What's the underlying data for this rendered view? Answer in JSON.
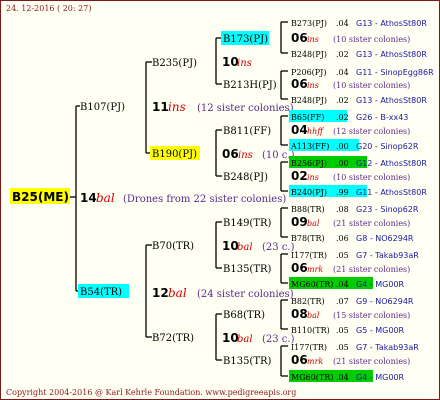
{
  "date": "24. 12-2016 ( 20: 27)",
  "footer": "Copyright 2004-2016 @ Karl Kehrle Foundation.   www.pedigreeapis.org",
  "colors": {
    "yellow": "#ffff00",
    "cyan": "#00ffff",
    "green": "#00cc00",
    "brown": "#8a1a1a",
    "purple": "#5a2a8a",
    "red": "#d00000",
    "blue": "#1a1aa0"
  },
  "root": {
    "id": "B25(ME)",
    "num": "14",
    "ins": "bal",
    "note": "(Drones from 22 sister colonies)"
  },
  "g1": [
    {
      "id": "B107(PJ)",
      "num": "11",
      "ins": "ins",
      "note": "(12 sister colonies)"
    },
    {
      "id": "B54(TR)",
      "num": "12",
      "ins": "bal",
      "note": "(24 sister colonies)"
    }
  ],
  "g2": [
    {
      "id": "B235(PJ)",
      "num": "10",
      "ins": "ins",
      "note": ""
    },
    {
      "id": "B190(PJ)",
      "num": "06",
      "ins": "ins",
      "note": "(10 c.)"
    },
    {
      "id": "B70(TR)",
      "num": "10",
      "ins": "bal",
      "note": "(23 c.)"
    },
    {
      "id": "B72(TR)",
      "num": "10",
      "ins": "bal",
      "note": "(23 c.)"
    }
  ],
  "g3": [
    "B173(PJ)",
    "B213H(PJ)",
    "B811(FF)",
    "B248(PJ)",
    "B149(TR)",
    "B135(TR)",
    "B68(TR)",
    "B135(TR)"
  ],
  "g4": [
    {
      "id": "B273(PJ)",
      "yr": ".04",
      "ref": "G13 - AthosSt80R"
    },
    {
      "num": "06",
      "ins": "ins",
      "note": "(10 sister colonies)"
    },
    {
      "id": "B248(PJ)",
      "yr": ".02",
      "ref": "G13 - AthosSt80R"
    },
    {
      "id": "P206(PJ)",
      "yr": ".04",
      "ref": "G11 - SinopEgg86R"
    },
    {
      "num": "06",
      "ins": "ins",
      "note": "(10 sister colonies)"
    },
    {
      "id": "B248(PJ)",
      "yr": ".02",
      "ref": "G13 - AthosSt80R"
    },
    {
      "id": "B65(FF)",
      "yr": ".02",
      "ref": "G26 - B-xx43"
    },
    {
      "num": "04",
      "ins": "hhff",
      "note": "(12 sister colonies)"
    },
    {
      "id": "A113(FF)",
      "yr": ".00",
      "ref": "G20 - Sinop62R"
    },
    {
      "id": "B256(PJ)",
      "yr": ".00",
      "ref": "G12 - AthosSt80R"
    },
    {
      "num": "02",
      "ins": "ins",
      "note": "(10 sister colonies)"
    },
    {
      "id": "B240(PJ)",
      "yr": ".99",
      "ref": "G11 - AthosSt80R"
    },
    {
      "id": "B88(TR)",
      "yr": ".08",
      "ref": "G23 - Sinop62R"
    },
    {
      "num": "09",
      "ins": "bal",
      "note": "(21 sister colonies)"
    },
    {
      "id": "B78(TR)",
      "yr": ".06",
      "ref": "G8 - NO6294R"
    },
    {
      "id": "I177(TR)",
      "yr": ".05",
      "ref": "G7 - Takab93aR"
    },
    {
      "num": "06",
      "ins": "mrk",
      "note": "(21 sister colonies)"
    },
    {
      "id": "MG60(TR)",
      "yr": ".04",
      "ref": "G4 - MG00R"
    },
    {
      "id": "B82(TR)",
      "yr": ".07",
      "ref": "G9 - NO6294R"
    },
    {
      "num": "08",
      "ins": "bal",
      "note": "(15 sister colonies)"
    },
    {
      "id": "B110(TR)",
      "yr": ".05",
      "ref": "G5 - MG00R"
    },
    {
      "id": "I177(TR)",
      "yr": ".05",
      "ref": "G7 - Takab93aR"
    },
    {
      "num": "06",
      "ins": "mrk",
      "note": "(21 sister colonies)"
    },
    {
      "id": "MG60(TR)",
      "yr": ".04",
      "ref": "G4 - MG00R"
    }
  ]
}
